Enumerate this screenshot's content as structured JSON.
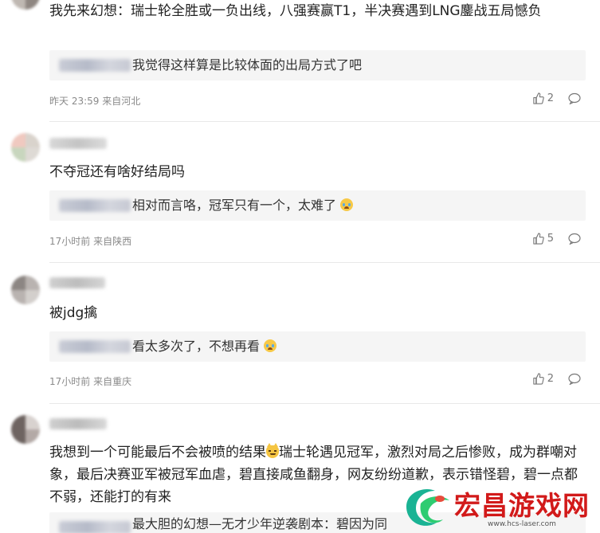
{
  "comments": [
    {
      "text": "我先来幻想：瑞士轮全胜或一负出线，八强赛赢T1，半决赛遇到LNG鏖战五局憾负",
      "reply": "我觉得这样算是比较体面的出局方式了吧",
      "meta": "昨天 23:59 来自河北",
      "likes": "2"
    },
    {
      "text": "不夺冠还有啥好结局吗",
      "reply": "相对而言咯，冠军只有一个，太难了",
      "meta": "17小时前 来自陕西",
      "likes": "5"
    },
    {
      "text": "被jdg擒",
      "reply": "看太多次了，不想再看",
      "meta": "17小时前 来自重庆",
      "likes": "2"
    },
    {
      "text_before_emoji": "我想到一个可能最后不会被喷的结果",
      "text_after_emoji": "瑞士轮遇见冠军，激烈对局之后惨败，成为群嘲对象，最后决赛亚军被冠军血虐，碧直接咸鱼翻身，网友纷纷道歉，表示错怪碧，碧一点都不弱，还能打的有来",
      "reply": "最大胆的幻想—无才少年逆袭剧本：碧因为同"
    }
  ],
  "watermark": {
    "title": "宏昌游戏网",
    "url": "www.hcs-laser.com"
  },
  "icons": {
    "like": "thumbs-up-icon",
    "reply": "comment-bubble-icon",
    "emoji_cry": "crying-face-emoji",
    "emoji_cat": "smirking-cat-emoji"
  }
}
